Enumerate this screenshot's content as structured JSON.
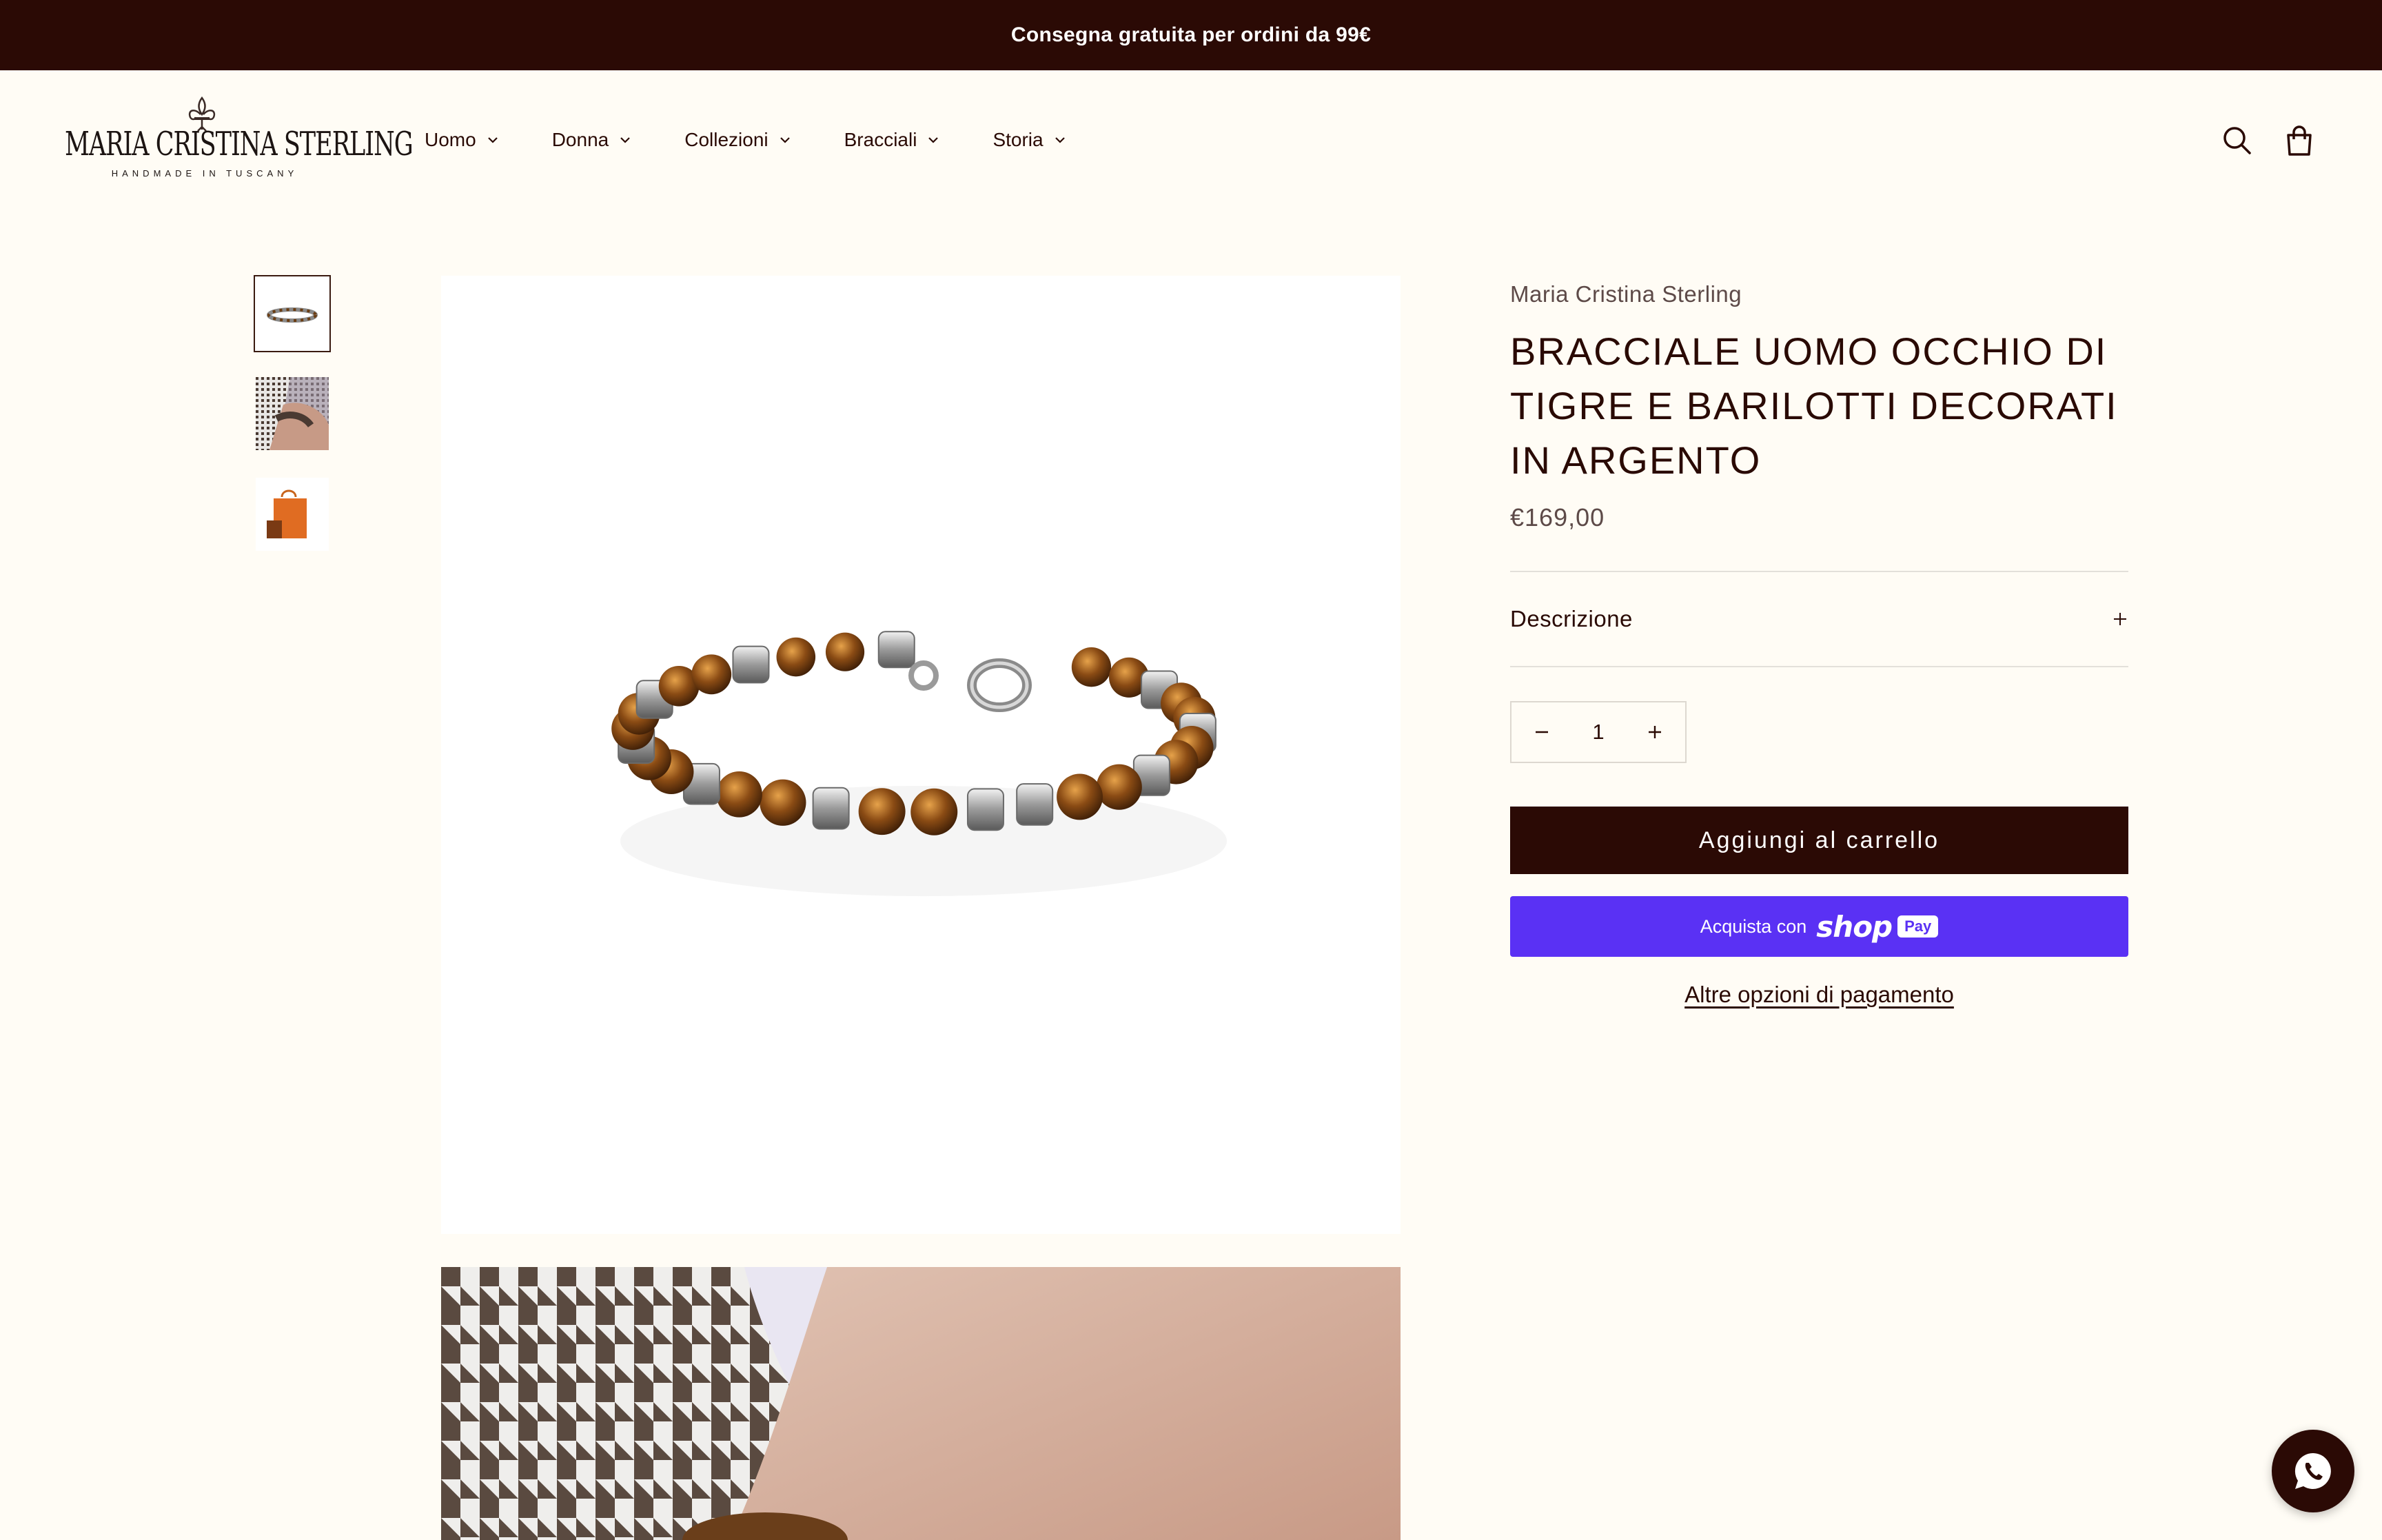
{
  "announcement": "Consegna gratuita per ordini da 99€",
  "logo": {
    "wordmark": "MARIA CRISTINA STERLING",
    "tagline": "HANDMADE IN TUSCANY"
  },
  "nav": [
    {
      "label": "Uomo"
    },
    {
      "label": "Donna"
    },
    {
      "label": "Collezioni"
    },
    {
      "label": "Bracciali"
    },
    {
      "label": "Storia"
    }
  ],
  "header_icons": [
    "search-icon",
    "bag-icon"
  ],
  "product": {
    "vendor": "Maria Cristina Sterling",
    "title": "BRACCIALE UOMO OCCHIO DI TIGRE E BARILOTTI DECORATI IN ARGENTO",
    "price": "€169,00",
    "accordion_label": "Descrizione",
    "quantity": "1",
    "add_to_cart": "Aggiungi al carrello",
    "shoppay_label": "Acquista con",
    "shoppay_brand": "shop",
    "shoppay_pay": "Pay",
    "other_payment": "Altre opzioni di pagamento"
  },
  "colors": {
    "dark_brown": "#2b0a05",
    "cream_bg": "#fffcf5",
    "shop_pay_purple": "#5a31f4"
  }
}
